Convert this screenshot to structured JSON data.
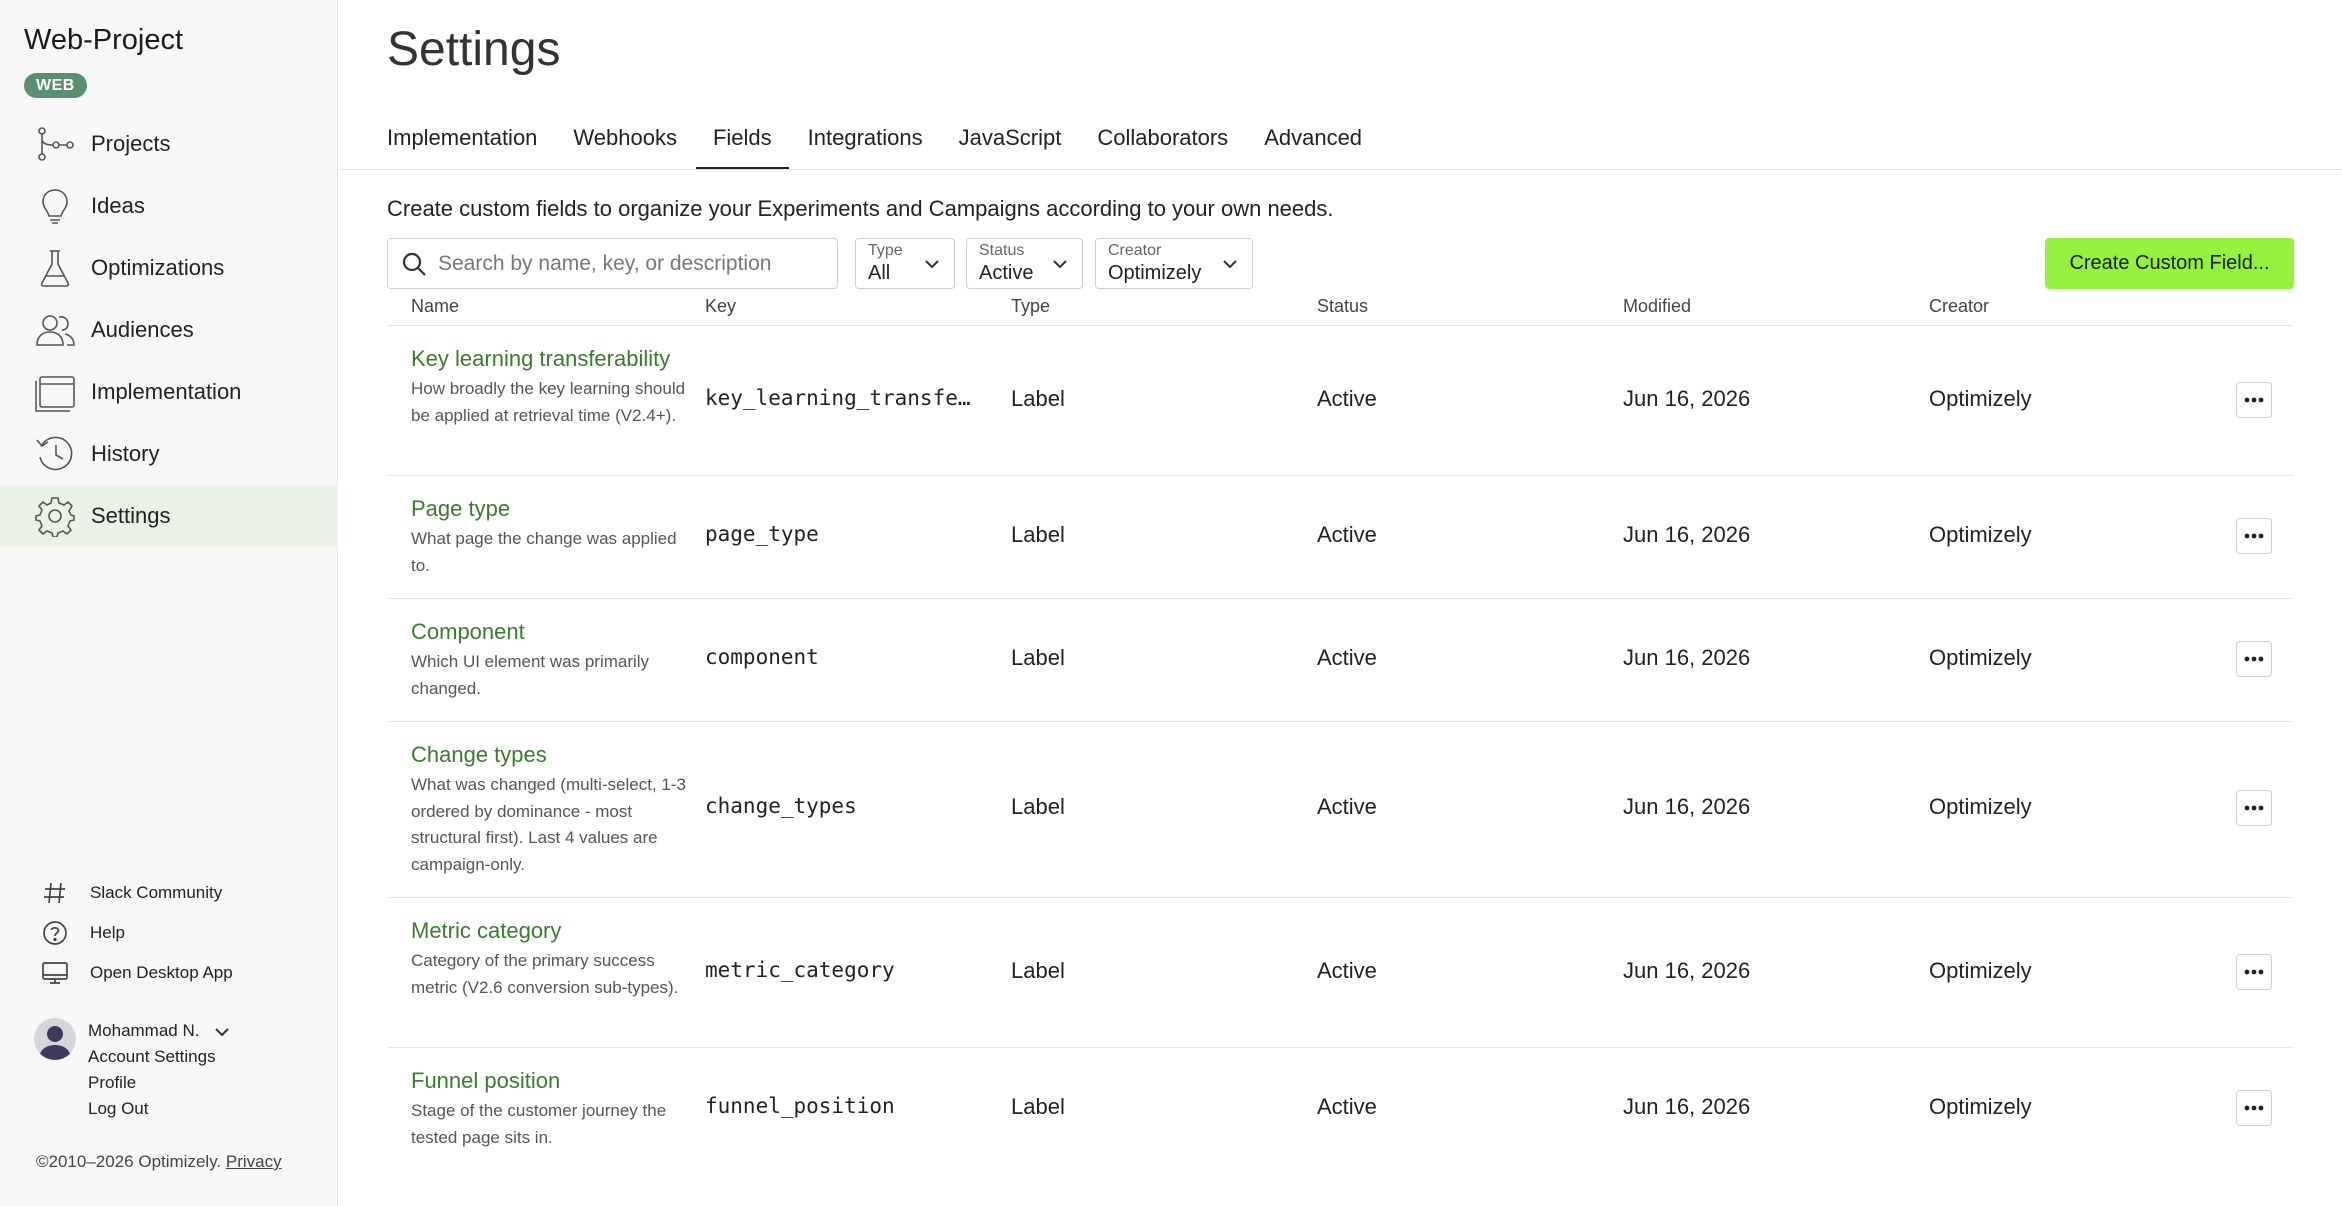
{
  "sidebar": {
    "project_title": "Web-Project",
    "project_badge": "WEB",
    "nav": [
      {
        "label": "Projects",
        "icon": "projects-icon"
      },
      {
        "label": "Ideas",
        "icon": "lightbulb-icon"
      },
      {
        "label": "Optimizations",
        "icon": "flask-icon"
      },
      {
        "label": "Audiences",
        "icon": "audiences-icon"
      },
      {
        "label": "Implementation",
        "icon": "browser-window-icon"
      },
      {
        "label": "History",
        "icon": "history-icon"
      },
      {
        "label": "Settings",
        "icon": "gear-icon",
        "active": true
      }
    ],
    "footer_links": [
      {
        "label": "Slack Community",
        "icon": "hash-icon"
      },
      {
        "label": "Help",
        "icon": "help-icon"
      },
      {
        "label": "Open Desktop App",
        "icon": "monitor-icon"
      }
    ],
    "user": {
      "name": "Mohammad N.",
      "links": [
        "Account Settings",
        "Profile",
        "Log Out"
      ]
    },
    "copyright": "©2010–2026 Optimizely.",
    "privacy": "Privacy"
  },
  "main": {
    "title": "Settings",
    "tabs": [
      "Implementation",
      "Webhooks",
      "Fields",
      "Integrations",
      "JavaScript",
      "Collaborators",
      "Advanced"
    ],
    "active_tab": "Fields",
    "description": "Create custom fields to organize your Experiments and Campaigns according to your own needs.",
    "search_placeholder": "Search by name, key, or description",
    "filters": {
      "type": {
        "label": "Type",
        "value": "All"
      },
      "status": {
        "label": "Status",
        "value": "Active"
      },
      "creator": {
        "label": "Creator",
        "value": "Optimizely"
      }
    },
    "create_button": "Create Custom Field...",
    "columns": [
      "Name",
      "Key",
      "Type",
      "Status",
      "Modified",
      "Creator"
    ],
    "rows": [
      {
        "name": "Key learning transferability",
        "description": "How broadly the key learning should be applied at retrieval time (V2.4+).",
        "key": "key_learning_transfe…",
        "type": "Label",
        "status": "Active",
        "modified": "Jun 16, 2026",
        "creator": "Optimizely"
      },
      {
        "name": "Page type",
        "description": "What page the change was applied to.",
        "key": "page_type",
        "type": "Label",
        "status": "Active",
        "modified": "Jun 16, 2026",
        "creator": "Optimizely"
      },
      {
        "name": "Component",
        "description": "Which UI element was primarily changed.",
        "key": "component",
        "type": "Label",
        "status": "Active",
        "modified": "Jun 16, 2026",
        "creator": "Optimizely"
      },
      {
        "name": "Change types",
        "description": "What was changed (multi-select, 1-3 ordered by dominance - most structural first). Last 4 values are campaign-only.",
        "key": "change_types",
        "type": "Label",
        "status": "Active",
        "modified": "Jun 16, 2026",
        "creator": "Optimizely"
      },
      {
        "name": "Metric category",
        "description": "Category of the primary success metric (V2.6 conversion sub-types).",
        "key": "metric_category",
        "type": "Label",
        "status": "Active",
        "modified": "Jun 16, 2026",
        "creator": "Optimizely"
      },
      {
        "name": "Funnel position",
        "description": "Stage of the customer journey the tested page sits in.",
        "key": "funnel_position",
        "type": "Label",
        "status": "Active",
        "modified": "Jun 16, 2026",
        "creator": "Optimizely"
      }
    ]
  }
}
